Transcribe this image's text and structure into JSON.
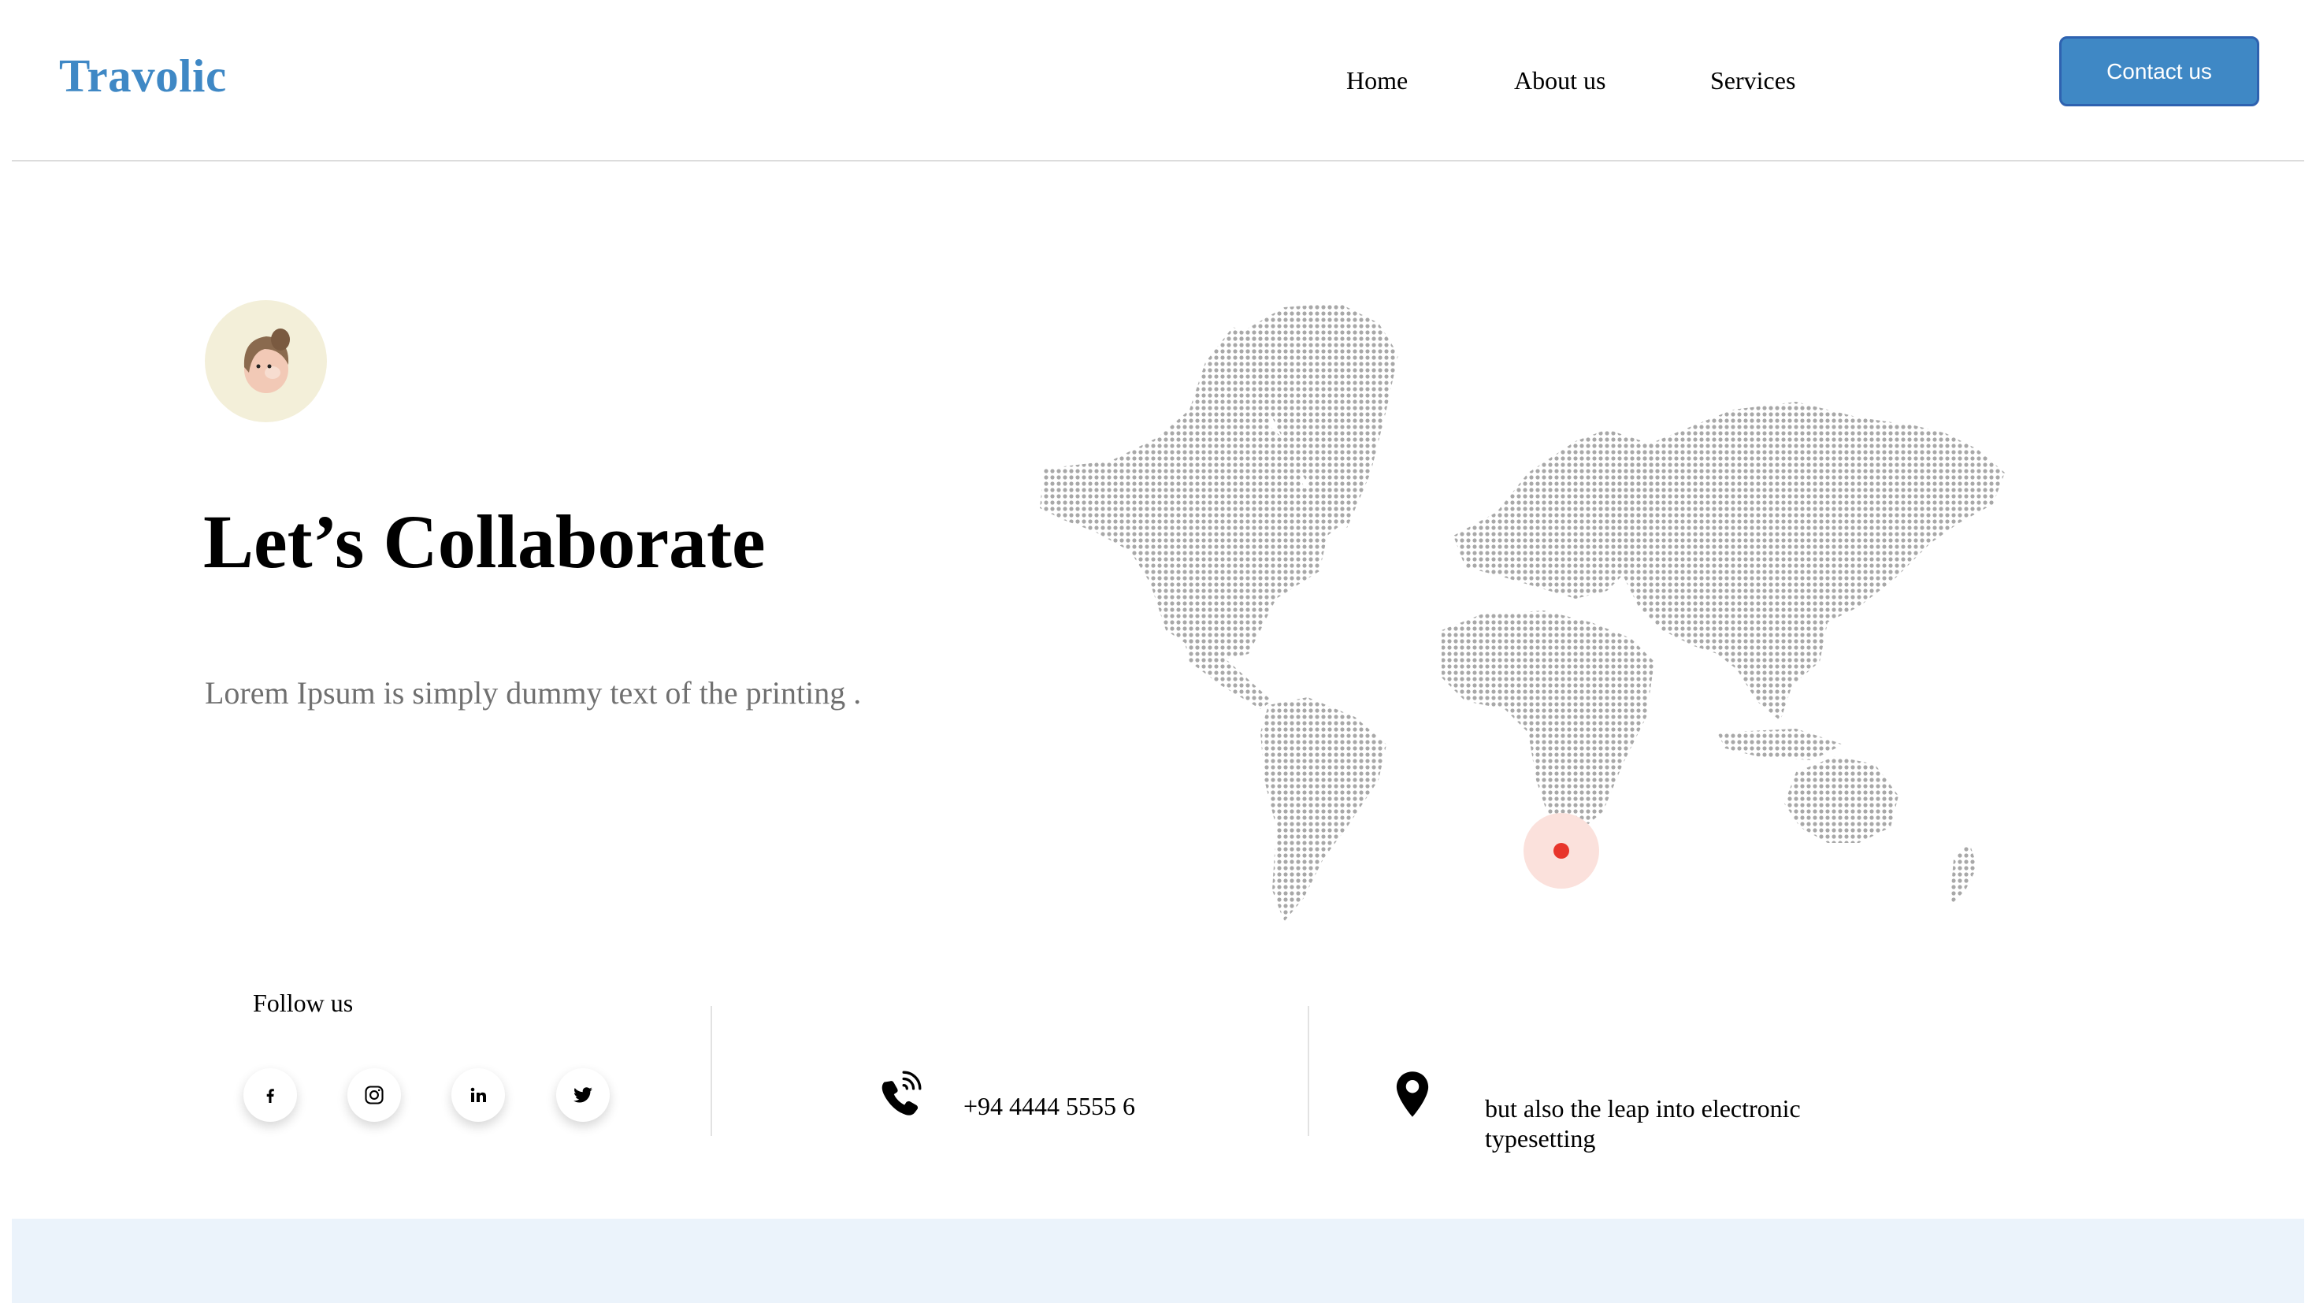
{
  "header": {
    "logo": "Travolic",
    "nav": [
      "Home",
      "About us",
      "Services"
    ],
    "contact_button": "Contact us"
  },
  "hero": {
    "title": "Let’s Collaborate",
    "subtitle": "Lorem Ipsum is simply dummy text of the printing ."
  },
  "map": {
    "icon": "world-map-dotted",
    "marker_color": "#e8352b",
    "dot_color": "#a8a8a8"
  },
  "follow": {
    "label": "Follow us",
    "socials": [
      "facebook-icon",
      "instagram-icon",
      "linkedin-icon",
      "twitter-icon"
    ]
  },
  "contact": {
    "phone": "+94 4444 5555 6",
    "address": "but also the leap into electronic typesetting"
  },
  "colors": {
    "accent": "#3f88c5",
    "footer_band": "#ebf3fb"
  }
}
